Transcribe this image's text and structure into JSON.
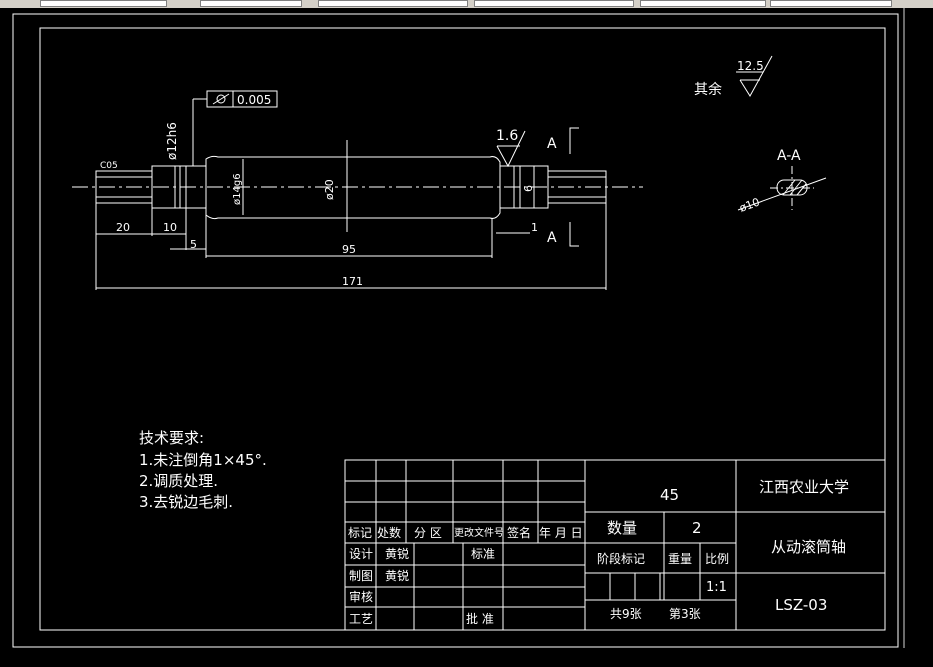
{
  "section": {
    "label_top": "A",
    "label_bottom": "A",
    "view_title": "A-A",
    "view_dia": "ø10"
  },
  "roughness": {
    "other_label": "其余",
    "other_value": "12.5",
    "local_value": "1.6"
  },
  "tolerance": {
    "value": "0.005",
    "symbol": "circular-runout"
  },
  "dims": {
    "chamfer": "C05",
    "d_left": "ø12h6",
    "d_mid": "ø14g6",
    "d_center": "ø20",
    "d_right": "6",
    "len_20": "20",
    "len_10": "10",
    "len_5": "5",
    "len_95": "95",
    "len_171": "171",
    "len_1": "1"
  },
  "notes": {
    "title": "技术要求:",
    "items": [
      "1.未注倒角1×45°.",
      "2.调质处理.",
      "3.去锐边毛刺."
    ]
  },
  "titleblock": {
    "material": "45",
    "school": "江西农业大学",
    "part_name": "从动滚筒轴",
    "drawing_no": "LSZ-03",
    "qty_label": "数量",
    "qty_value": "2",
    "stage_label": "阶段标记",
    "weight_label": "重量",
    "scale_label": "比例",
    "scale_value": "1:1",
    "sheets_total": "共9张",
    "sheet_no": "第3张",
    "header": {
      "mark": "标记",
      "count": "处数",
      "zone": "分  区",
      "doc_no": "更改文件号",
      "sign": "签名",
      "date": "年 月 日"
    },
    "rows": {
      "design": "设计",
      "design_name": "黄锐",
      "standard": "标准",
      "draw": "制图",
      "draw_name": "黄锐",
      "review": "审核",
      "process": "工艺",
      "approve": "批  准"
    }
  }
}
